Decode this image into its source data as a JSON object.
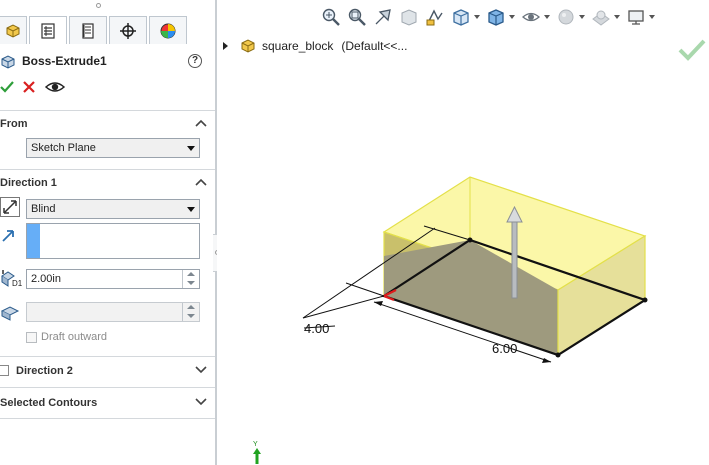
{
  "property_manager": {
    "tabs": [
      {
        "name": "featuremanager",
        "icon": "feature-manager-icon"
      },
      {
        "name": "propertymanager",
        "icon": "property-manager-icon"
      },
      {
        "name": "configurationmanager",
        "icon": "configuration-manager-icon"
      },
      {
        "name": "dimxpertmanager",
        "icon": "dimxpert-icon"
      },
      {
        "name": "displaymanager",
        "icon": "display-manager-icon"
      }
    ],
    "feature_title": "Boss-Extrude1",
    "help_label": "?",
    "sections": {
      "from": {
        "title": "From",
        "start_condition": "Sketch Plane"
      },
      "direction1": {
        "title": "Direction 1",
        "end_condition": "Blind",
        "depth": "2.00in",
        "draft_label": "Draft outward"
      },
      "direction2": {
        "title": "Direction 2",
        "checked": false
      },
      "selected_contours": {
        "title": "Selected Contours"
      }
    }
  },
  "viewport": {
    "heads_up_toolbar": [
      "zoom-to-fit-icon",
      "zoom-to-area-icon",
      "previous-view-icon",
      "section-view-icon",
      "dynamic-annotation-icon",
      "view-orientation-icon",
      "display-style-icon",
      "hide-show-items-icon",
      "edit-appearance-icon",
      "apply-scene-icon",
      "view-settings-icon"
    ],
    "tree": {
      "part_name": "square_block",
      "configuration": "(Default<<..."
    },
    "dimensions": {
      "width": "4.00",
      "length": "6.00"
    },
    "triad_label": "Y"
  },
  "colors": {
    "preview_yellow": "#f7f28a",
    "preview_edge": "#e3e04a",
    "selection_blue": "#66aef7",
    "ok_green": "#2e9e3a",
    "cancel_red": "#d92020"
  }
}
